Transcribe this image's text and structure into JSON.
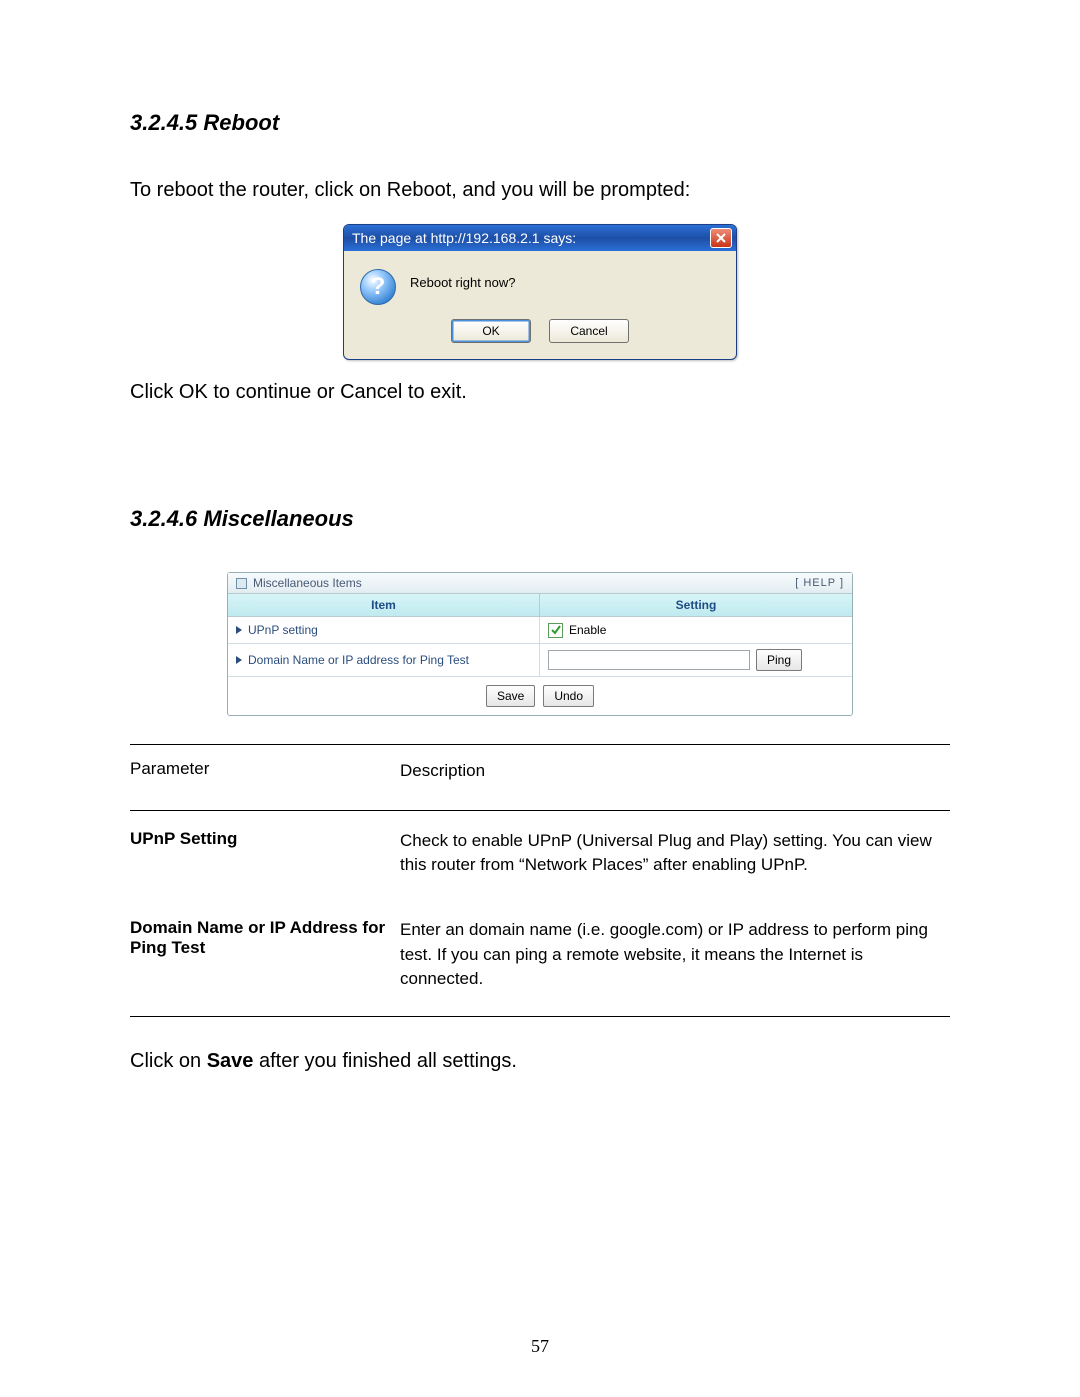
{
  "sections": {
    "reboot": {
      "heading": "3.2.4.5 Reboot",
      "intro": "To reboot the router, click on Reboot, and you will be prompted:",
      "post_dialog": "Click OK to continue or Cancel to exit."
    },
    "misc": {
      "heading": "3.2.4.6 Miscellaneous",
      "save_note_prefix": "Click on ",
      "save_note_bold": "Save",
      "save_note_suffix": " after you finished all settings."
    }
  },
  "xp_dialog": {
    "title": "The page at http://192.168.2.1 says:",
    "question_glyph": "?",
    "message": "Reboot right now?",
    "ok_label": "OK",
    "cancel_label": "Cancel"
  },
  "router_panel": {
    "title": "Miscellaneous Items",
    "help_label": "[ HELP ]",
    "col_item": "Item",
    "col_setting": "Setting",
    "rows": {
      "upnp": {
        "label": "UPnP setting",
        "enable_label": "Enable",
        "checked": true
      },
      "ping": {
        "label": "Domain Name or IP address for Ping Test",
        "input_value": "",
        "button_label": "Ping"
      }
    },
    "save_label": "Save",
    "undo_label": "Undo"
  },
  "desc_table": {
    "head_param": "Parameter",
    "head_desc": "Description",
    "rows": [
      {
        "param": "UPnP Setting",
        "desc": "Check to enable UPnP (Universal Plug and Play) setting. You can view this router from “Network Places” after enabling UPnP."
      },
      {
        "param": "Domain Name or IP Address for Ping Test",
        "desc": "Enter an domain name (i.e. google.com) or IP address to perform ping test. If you can ping a remote website, it means the Internet is connected."
      }
    ]
  },
  "page_number": "57"
}
